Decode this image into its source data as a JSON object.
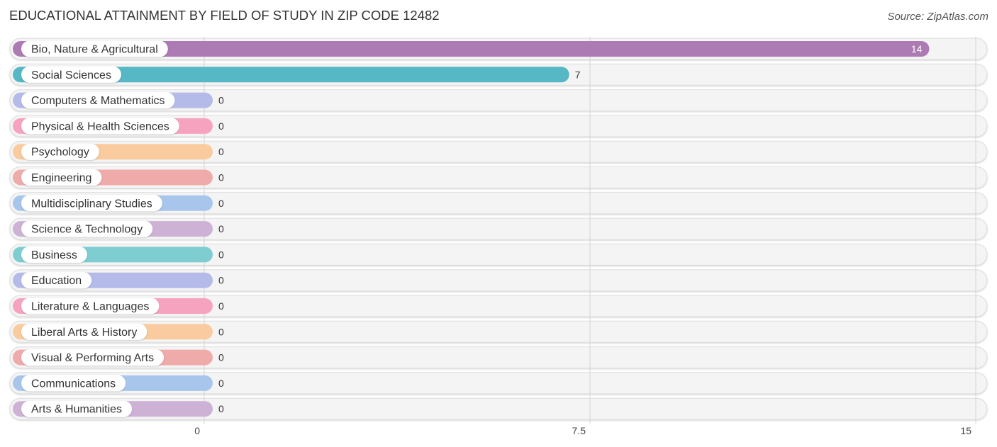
{
  "header": {
    "title": "EDUCATIONAL ATTAINMENT BY FIELD OF STUDY IN ZIP CODE 12482",
    "source": "Source: ZipAtlas.com"
  },
  "chart_data": {
    "type": "bar",
    "orientation": "horizontal",
    "title": "EDUCATIONAL ATTAINMENT BY FIELD OF STUDY IN ZIP CODE 12482",
    "xlabel": "",
    "ylabel": "",
    "xlim": [
      0,
      15
    ],
    "ticks": [
      0,
      7.5,
      15
    ],
    "tick_labels": [
      "0",
      "7.5",
      "15"
    ],
    "grid": true,
    "categories": [
      "Bio, Nature & Agricultural",
      "Social Sciences",
      "Computers & Mathematics",
      "Physical & Health Sciences",
      "Psychology",
      "Engineering",
      "Multidisciplinary Studies",
      "Science & Technology",
      "Business",
      "Education",
      "Literature & Languages",
      "Liberal Arts & History",
      "Visual & Performing Arts",
      "Communications",
      "Arts & Humanities"
    ],
    "values": [
      14,
      7,
      0,
      0,
      0,
      0,
      0,
      0,
      0,
      0,
      0,
      0,
      0,
      0,
      0
    ],
    "value_labels": [
      "14",
      "7",
      "0",
      "0",
      "0",
      "0",
      "0",
      "0",
      "0",
      "0",
      "0",
      "0",
      "0",
      "0",
      "0"
    ],
    "colors": [
      "#ad7bb3",
      "#55b8c4",
      "#b4bbe8",
      "#f6a3bf",
      "#f9cb9e",
      "#efaaaa",
      "#a8c6ec",
      "#cdb2d6",
      "#7ecdd1",
      "#b4bbe8",
      "#f6a3bf",
      "#f9cb9e",
      "#efaaaa",
      "#a8c6ec",
      "#cdb2d6"
    ]
  }
}
